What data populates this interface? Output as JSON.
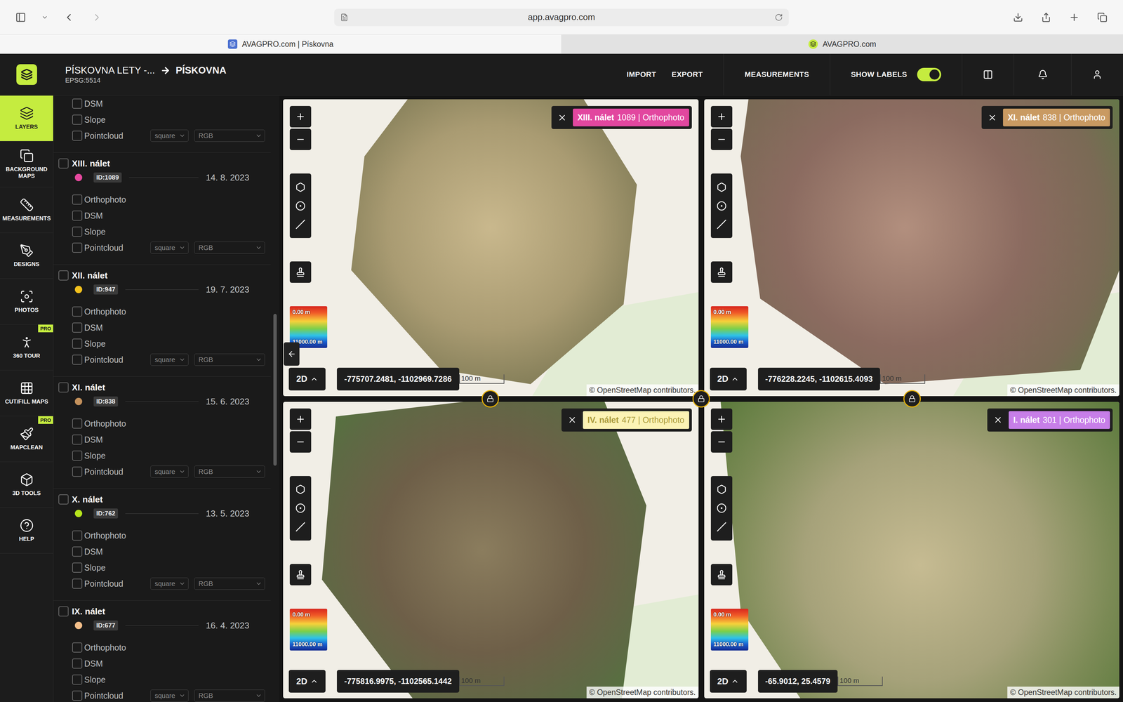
{
  "browser": {
    "url": "app.avagpro.com",
    "tabs": [
      {
        "label": "AVAGPRO.com | Pískovna",
        "selected": true
      },
      {
        "label": "AVAGPRO.com",
        "selected": false
      }
    ]
  },
  "header": {
    "project": "PÍSKOVNA LETY -...",
    "site": "PÍSKOVNA",
    "epsg": "EPSG:5514",
    "nav": [
      "IMPORT",
      "EXPORT",
      "MEASUREMENTS"
    ],
    "show_labels": {
      "label": "SHOW LABELS",
      "on": true
    }
  },
  "sidebar": {
    "items": [
      {
        "label": "LAYERS",
        "selected": true
      },
      {
        "label": "BACKGROUND MAPS",
        "selected": false
      },
      {
        "label": "MEASUREMENTS",
        "selected": false
      },
      {
        "label": "DESIGNS",
        "selected": false
      },
      {
        "label": "PHOTOS",
        "selected": false
      },
      {
        "label": "360 TOUR",
        "selected": false,
        "badge": "PRO"
      },
      {
        "label": "CUT/FILL MAPS",
        "selected": false
      },
      {
        "label": "MAPCLEAN",
        "selected": false,
        "badge": "PRO"
      },
      {
        "label": "3D TOOLS",
        "selected": false
      },
      {
        "label": "HELP",
        "selected": false
      }
    ]
  },
  "layers": {
    "scroll": {
      "top": 0.36,
      "size": 0.25
    },
    "partial": [
      {
        "label": "DSM",
        "checked": false,
        "kind": "check"
      },
      {
        "label": "Slope",
        "checked": false,
        "kind": "check"
      },
      {
        "label": "Pointcloud",
        "checked": false,
        "kind": "pointcloud",
        "shape": "square",
        "mode": "RGB"
      }
    ],
    "flights": [
      {
        "name": "XIII. nálet",
        "id": "ID:1089",
        "date": "14. 8. 2023",
        "color": "#e6489e",
        "checked": false,
        "layers": [
          {
            "label": "Orthophoto",
            "checked": false,
            "kind": "check"
          },
          {
            "label": "DSM",
            "checked": false,
            "kind": "check"
          },
          {
            "label": "Slope",
            "checked": false,
            "kind": "check"
          },
          {
            "label": "Pointcloud",
            "checked": false,
            "kind": "pointcloud",
            "shape": "square",
            "mode": "RGB"
          }
        ]
      },
      {
        "name": "XII. nálet",
        "id": "ID:947",
        "date": "19. 7. 2023",
        "color": "#f2c11d",
        "checked": false,
        "layers": [
          {
            "label": "Orthophoto",
            "checked": false,
            "kind": "check"
          },
          {
            "label": "DSM",
            "checked": false,
            "kind": "check"
          },
          {
            "label": "Slope",
            "checked": false,
            "kind": "check"
          },
          {
            "label": "Pointcloud",
            "checked": false,
            "kind": "pointcloud",
            "shape": "square",
            "mode": "RGB"
          }
        ]
      },
      {
        "name": "XI. nálet",
        "id": "ID:838",
        "date": "15. 6. 2023",
        "color": "#c4915c",
        "checked": false,
        "layers": [
          {
            "label": "Orthophoto",
            "checked": false,
            "kind": "check"
          },
          {
            "label": "DSM",
            "checked": false,
            "kind": "check"
          },
          {
            "label": "Slope",
            "checked": false,
            "kind": "check"
          },
          {
            "label": "Pointcloud",
            "checked": false,
            "kind": "pointcloud",
            "shape": "square",
            "mode": "RGB"
          }
        ]
      },
      {
        "name": "X. nálet",
        "id": "ID:762",
        "date": "13. 5. 2023",
        "color": "#b6e51c",
        "checked": false,
        "layers": [
          {
            "label": "Orthophoto",
            "checked": false,
            "kind": "check"
          },
          {
            "label": "DSM",
            "checked": false,
            "kind": "check"
          },
          {
            "label": "Slope",
            "checked": false,
            "kind": "check"
          },
          {
            "label": "Pointcloud",
            "checked": false,
            "kind": "pointcloud",
            "shape": "square",
            "mode": "RGB"
          }
        ]
      },
      {
        "name": "IX. nálet",
        "id": "ID:677",
        "date": "16. 4. 2023",
        "color": "#f4bf8a",
        "checked": false,
        "layers": [
          {
            "label": "Orthophoto",
            "checked": false,
            "kind": "check"
          },
          {
            "label": "DSM",
            "checked": false,
            "kind": "check"
          },
          {
            "label": "Slope",
            "checked": false,
            "kind": "check"
          },
          {
            "label": "Pointcloud",
            "checked": false,
            "kind": "pointcloud",
            "shape": "square",
            "mode": "RGB"
          }
        ]
      }
    ]
  },
  "maps": [
    {
      "name": "XIII. nálet",
      "detail": "1089 | Orthophoto",
      "color": "#e2479f",
      "faded": false,
      "coords": "-775707.2481, -1102969.7286",
      "mode": "2D",
      "scale": "100 m",
      "legend": {
        "top": "0.00 m",
        "bottom": "11000.00 m"
      },
      "attribution": "© OpenStreetMap contributors."
    },
    {
      "name": "XI. nálet",
      "detail": "838 | Orthophoto",
      "color": "#c99a62",
      "faded": false,
      "coords": "-776228.2245, -1102615.4093",
      "mode": "2D",
      "scale": "100 m",
      "legend": {
        "top": "0.00 m",
        "bottom": "11000.00 m"
      },
      "attribution": "© OpenStreetMap contributors."
    },
    {
      "name": "IV. nálet",
      "detail": "477 | Orthophoto",
      "color": "#fcf3b5",
      "faded": true,
      "coords": "-775816.9975, -1102565.1442",
      "mode": "2D",
      "scale": "100 m",
      "legend": {
        "top": "0.00 m",
        "bottom": "11000.00 m"
      },
      "attribution": "© OpenStreetMap contributors."
    },
    {
      "name": "I. nálet",
      "detail": "301 | Orthophoto",
      "color": "#c77ee8",
      "faded": false,
      "coords": "-65.9012, 25.4579",
      "mode": "2D",
      "scale": "100 m",
      "legend": {
        "top": "0.00 m",
        "bottom": "11000.00 m"
      },
      "attribution": "© OpenStreetMap contributors."
    }
  ]
}
